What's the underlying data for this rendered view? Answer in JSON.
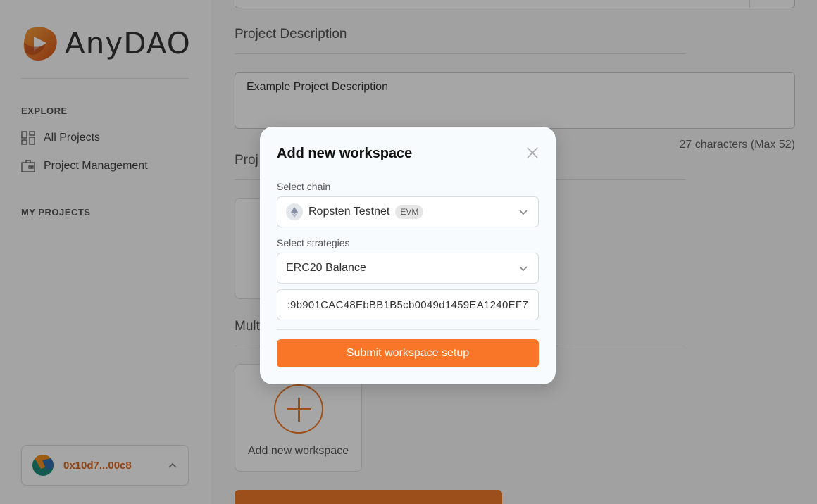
{
  "sidebar": {
    "logo_text": "AnyDAO",
    "explore_title": "EXPLORE",
    "nav_items": [
      {
        "label": "All Projects",
        "icon": "grid-icon"
      },
      {
        "label": "Project Management",
        "icon": "briefcase-icon"
      }
    ],
    "my_projects_title": "MY PROJECTS",
    "wallet": {
      "address": "0x10d7...00c8",
      "icon": "chevron-up-icon"
    }
  },
  "main": {
    "description_title": "Project Description",
    "description_value": "Example Project Description",
    "char_counter": "27 characters (Max 52)",
    "partial_title_1": "Proj",
    "partial_title_2": "Mult",
    "add_workspace_label": "Add new workspace"
  },
  "modal": {
    "title": "Add new workspace",
    "chain_label": "Select chain",
    "chain_value": "Ropsten Testnet",
    "chain_badge": "EVM",
    "strategies_label": "Select strategies",
    "strategy_value": "ERC20 Balance",
    "token_address": ":9b901CAC48EbBB1B5cb0049d1459EA1240EF7",
    "submit_label": "Submit workspace setup"
  },
  "colors": {
    "accent": "#f97628",
    "wallet_text": "#e06418"
  }
}
